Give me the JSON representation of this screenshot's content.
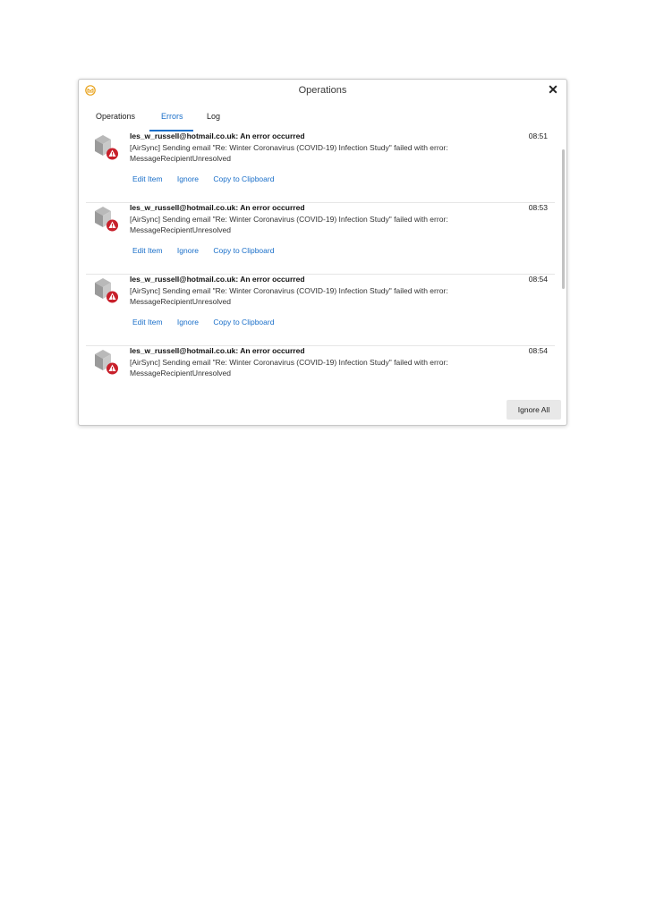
{
  "window": {
    "title": "Operations",
    "close_label": "✕",
    "accent": "#1a6fc9",
    "app_icon": "envelope-icon"
  },
  "tabs": [
    {
      "label": "Operations",
      "active": false
    },
    {
      "label": "Errors",
      "active": true
    },
    {
      "label": "Log",
      "active": false
    }
  ],
  "items": [
    {
      "title": "les_w_russell@hotmail.co.uk: An error occurred",
      "time": "08:51",
      "message_line1": "[AirSync] Sending email \"Re: Winter Coronavirus (COVID-19) Infection Study\" failed with error:",
      "message_line2": "MessageRecipientUnresolved",
      "icon": "package-error-icon",
      "actions": [
        "Edit Item",
        "Ignore",
        "Copy to Clipboard"
      ]
    },
    {
      "title": "les_w_russell@hotmail.co.uk: An error occurred",
      "time": "08:53",
      "message_line1": "[AirSync] Sending email \"Re: Winter Coronavirus (COVID-19) Infection Study\" failed with error:",
      "message_line2": "MessageRecipientUnresolved",
      "icon": "package-error-icon",
      "actions": [
        "Edit Item",
        "Ignore",
        "Copy to Clipboard"
      ]
    },
    {
      "title": "les_w_russell@hotmail.co.uk: An error occurred",
      "time": "08:54",
      "message_line1": "[AirSync] Sending email \"Re: Winter Coronavirus (COVID-19) Infection Study\" failed with error:",
      "message_line2": "MessageRecipientUnresolved",
      "icon": "package-error-icon",
      "actions": [
        "Edit Item",
        "Ignore",
        "Copy to Clipboard"
      ]
    },
    {
      "title": "les_w_russell@hotmail.co.uk: An error occurred",
      "time": "08:54",
      "message_line1": "[AirSync] Sending email \"Re: Winter Coronavirus (COVID-19) Infection Study\" failed with error:",
      "message_line2": "MessageRecipientUnresolved",
      "icon": "package-error-icon",
      "actions": []
    }
  ],
  "footer": {
    "ignore_all_label": "Ignore All"
  }
}
